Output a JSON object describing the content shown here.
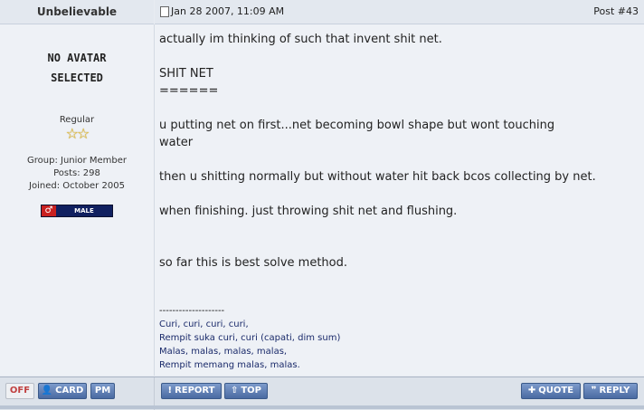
{
  "author": {
    "name": "Unbelievable",
    "avatar_lines": [
      "No Avatar",
      "Selected"
    ],
    "rank": "Regular",
    "stars": "☆☆",
    "group": "Group: Junior Member",
    "posts": "Posts: 298",
    "joined": "Joined: October 2005",
    "gender_symbol": "♂",
    "gender_label": "MALE",
    "gender_color": "#c82020"
  },
  "post": {
    "date": "Jan 28 2007, 11:09 AM",
    "number": "Post #43",
    "lines": [
      "actually im thinking of such that invent shit net.",
      "",
      "SHIT NET",
      "======",
      "",
      "u putting net on first...net becoming bowl shape but wont touching",
      "water",
      "",
      "then u shitting normally but without water hit back bcos collecting by net.",
      "",
      "when finishing. just throwing shit net and flushing.",
      "",
      "",
      "so far this is best solve method."
    ],
    "signature_divider": "--------------------",
    "signature": [
      "Curi, curi, curi, curi,",
      "Rempit suka curi, curi (capati, dim sum)",
      "Malas, malas, malas, malas,",
      "Rempit memang malas, malas."
    ]
  },
  "footer": {
    "off": "OFF",
    "card": "CARD",
    "pm": "PM",
    "report": "REPORT",
    "top": "TOP",
    "quote": "QUOTE",
    "reply": "REPLY"
  },
  "colors": {
    "button_blue": "#4a6aa2",
    "background": "#eef1f6",
    "star_gold": "#e8c23a"
  }
}
